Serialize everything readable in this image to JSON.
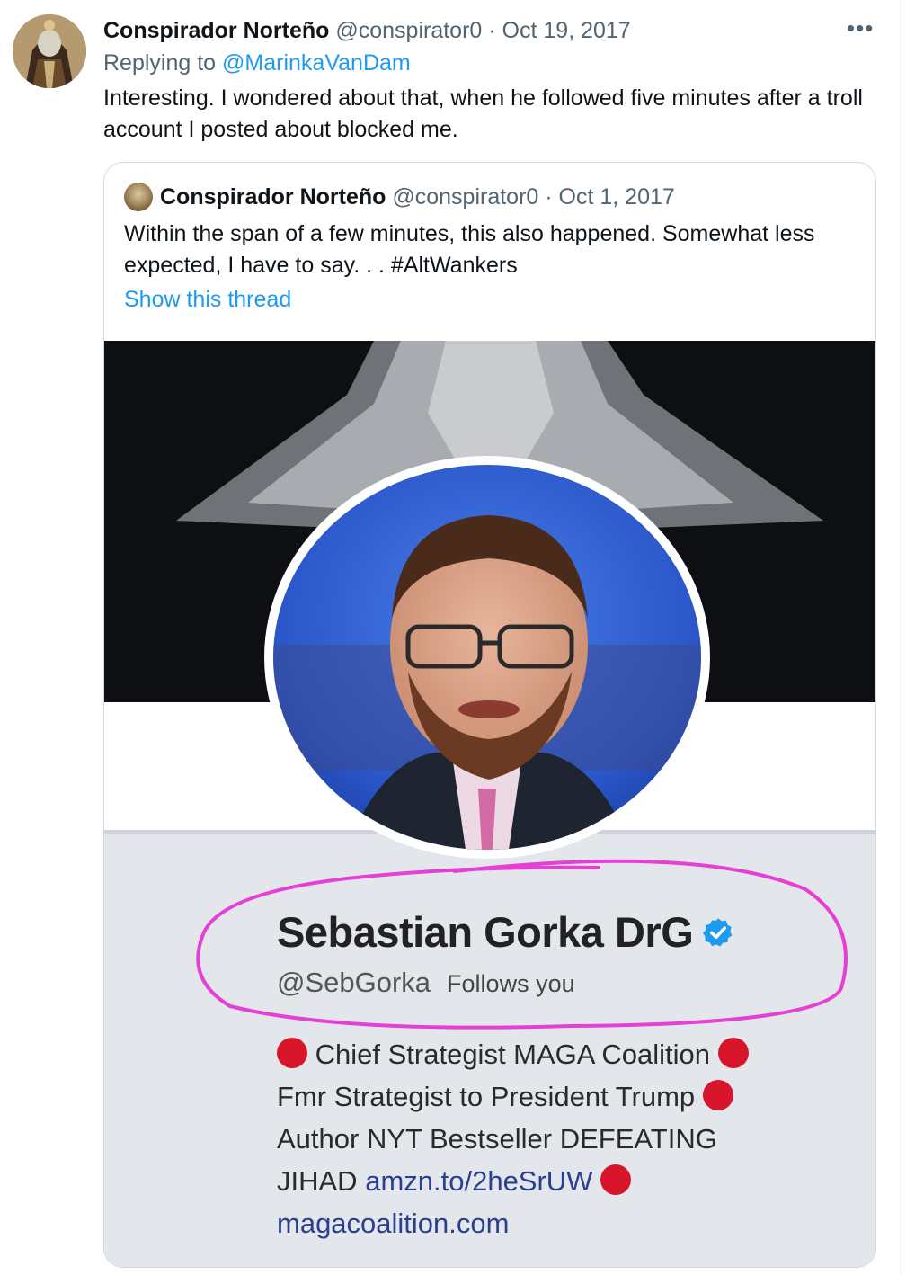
{
  "tweet": {
    "author_name": "Conspirador Norteño",
    "author_handle": "@conspirator0",
    "separator": "·",
    "date": "Oct 19, 2017",
    "more_icon": "•••",
    "replying_prefix": "Replying to",
    "replying_to": "@MarinkaVanDam",
    "text": "Interesting.  I wondered about that, when he followed five minutes after a troll account I posted about blocked me."
  },
  "quoted": {
    "author_name": "Conspirador Norteño",
    "author_handle": "@conspirator0",
    "separator": "·",
    "date": "Oct 1, 2017",
    "text": "Within the span of a few minutes, this also happened.  Somewhat less expected, I have to say. . . #AltWankers",
    "show_thread": "Show this thread"
  },
  "profile_card": {
    "name": "Sebastian Gorka DrG",
    "handle": "@SebGorka",
    "follows_you": "Follows you",
    "bio_line1": "Chief Strategist MAGA Coalition",
    "bio_line2": "Fmr Strategist to President Trump",
    "bio_line3": "Author NYT Bestseller DEFEATING",
    "bio_line4_text": "JIHAD",
    "bio_line4_link": "amzn.to/2heSrUW",
    "bio_line5_link": "magacoalition.com"
  },
  "colors": {
    "link": "#1d9bf0",
    "verified": "#1d9bf0",
    "bio_dot": "#d8152a",
    "annotation": "#e63fd6"
  }
}
